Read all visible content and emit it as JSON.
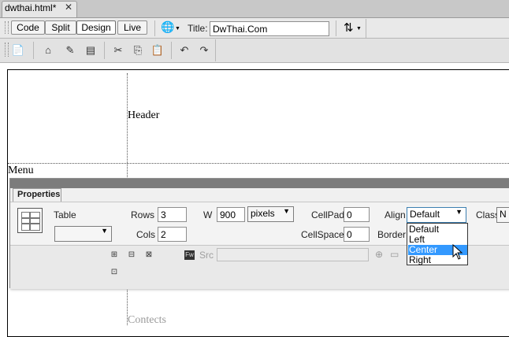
{
  "tab": {
    "title": "dwthai.html*",
    "close": "✕"
  },
  "doc_toolbar": {
    "views": [
      {
        "label": "Code"
      },
      {
        "label": "Split"
      },
      {
        "label": "Design"
      },
      {
        "label": "Live"
      }
    ],
    "active_view": "Design",
    "title_label": "Title:",
    "title_value": "DwThai.Com"
  },
  "icons": {
    "globe": "🌐",
    "arrows": "⇅",
    "new": "📄",
    "home": "⌂",
    "edit": "✎",
    "copy_doc": "▤",
    "cut": "✂",
    "copy": "⎘",
    "paste": "📋",
    "undo": "↶",
    "redo": "↷",
    "browse": "▢",
    "folder": "▭",
    "target": "⊕"
  },
  "design": {
    "header": "Header",
    "menu": "Menu",
    "contents": "Contects"
  },
  "properties": {
    "tab_label": "Properties",
    "table_label": "Table",
    "table_id_value": "",
    "rows_label": "Rows",
    "rows_value": "3",
    "cols_label": "Cols",
    "cols_value": "2",
    "w_label": "W",
    "w_value": "900",
    "w_unit": "pixels",
    "cellpad_label": "CellPad",
    "cellpad_value": "0",
    "cellspace_label": "CellSpace",
    "cellspace_value": "0",
    "align_label": "Align",
    "align_value": "Default",
    "border_label": "Border",
    "class_label": "Class",
    "class_value": "N",
    "src_label": "Src",
    "fw_badge": "Fw",
    "align_options": [
      "Default",
      "Left",
      "Center",
      "Right"
    ],
    "align_highlighted": "Center"
  }
}
